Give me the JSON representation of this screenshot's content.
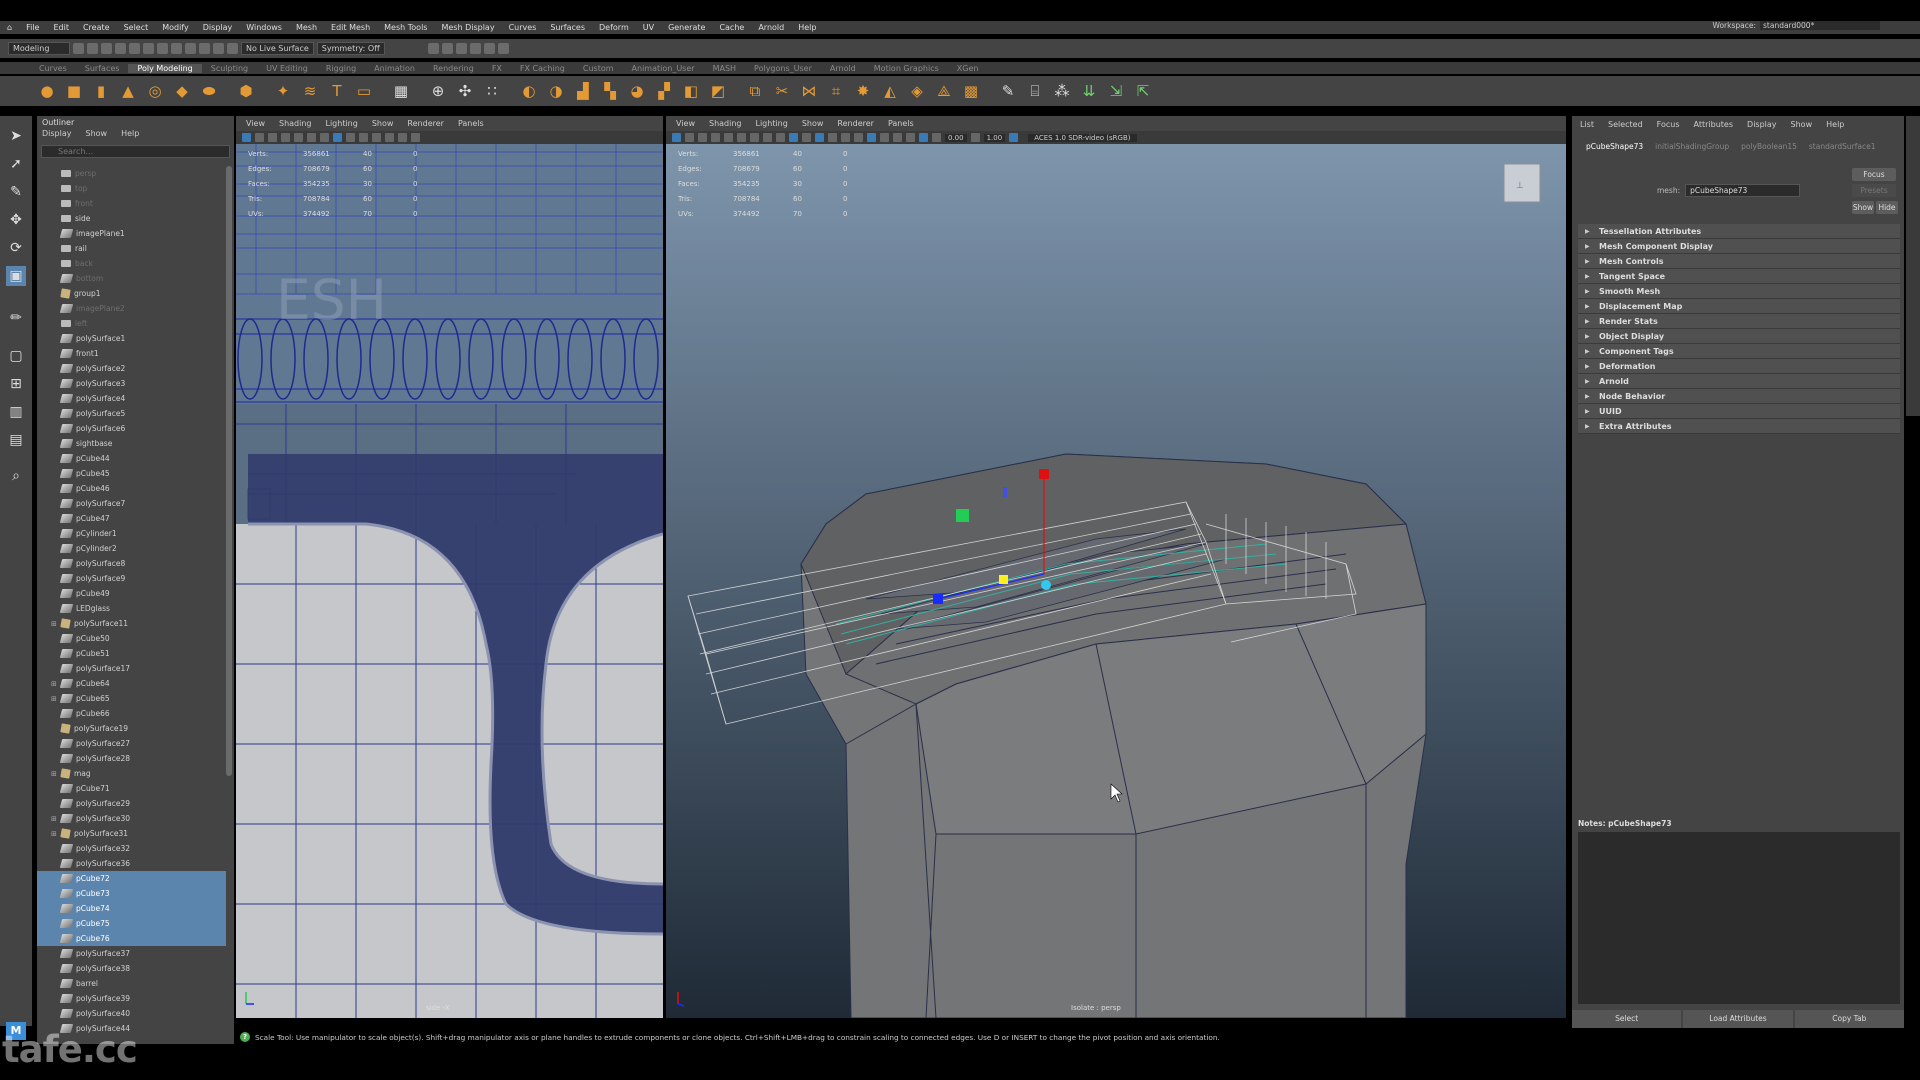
{
  "menubar": [
    "File",
    "Edit",
    "Create",
    "Select",
    "Modify",
    "Display",
    "Windows",
    "Mesh",
    "Edit Mesh",
    "Mesh Tools",
    "Mesh Display",
    "Curves",
    "Surfaces",
    "Deform",
    "UV",
    "Generate",
    "Cache",
    "Arnold",
    "Help"
  ],
  "workspace": {
    "label": "Workspace:",
    "value": "standard000*"
  },
  "status_line": {
    "mode": "Modeling",
    "live_surface": "No Live Surface",
    "symmetry": "Symmetry: Off"
  },
  "shelf_tabs": [
    "Curves",
    "Surfaces",
    "Poly Modeling",
    "Sculpting",
    "UV Editing",
    "Rigging",
    "Animation",
    "Rendering",
    "FX",
    "FX Caching",
    "Custom",
    "Animation_User",
    "MASH",
    "Polygons_User",
    "Arnold",
    "Motion Graphics",
    "XGen"
  ],
  "shelf_active_tab": "Poly Modeling",
  "outliner": {
    "title": "Outliner",
    "menu": [
      "Display",
      "Show",
      "Help"
    ],
    "search_placeholder": "Search...",
    "items": [
      {
        "label": "persp",
        "icon": "cam",
        "dim": true
      },
      {
        "label": "top",
        "icon": "cam",
        "dim": true
      },
      {
        "label": "front",
        "icon": "cam",
        "dim": true
      },
      {
        "label": "side",
        "icon": "cam"
      },
      {
        "label": "imagePlane1",
        "icon": "mesh"
      },
      {
        "label": "rail",
        "icon": "cam"
      },
      {
        "label": "back",
        "icon": "cam",
        "dim": true
      },
      {
        "label": "bottom",
        "icon": "mesh",
        "dim": true
      },
      {
        "label": "group1",
        "icon": "grp"
      },
      {
        "label": "imagePlane2",
        "icon": "mesh",
        "dim": true
      },
      {
        "label": "left",
        "icon": "cam",
        "dim": true
      },
      {
        "label": "polySurface1",
        "icon": "mesh"
      },
      {
        "label": "front1",
        "icon": "mesh"
      },
      {
        "label": "polySurface2",
        "icon": "mesh"
      },
      {
        "label": "polySurface3",
        "icon": "mesh"
      },
      {
        "label": "polySurface4",
        "icon": "mesh"
      },
      {
        "label": "polySurface5",
        "icon": "mesh"
      },
      {
        "label": "polySurface6",
        "icon": "mesh"
      },
      {
        "label": "sightbase",
        "icon": "mesh"
      },
      {
        "label": "pCube44",
        "icon": "mesh"
      },
      {
        "label": "pCube45",
        "icon": "mesh"
      },
      {
        "label": "pCube46",
        "icon": "mesh"
      },
      {
        "label": "polySurface7",
        "icon": "mesh"
      },
      {
        "label": "pCube47",
        "icon": "mesh"
      },
      {
        "label": "pCylinder1",
        "icon": "mesh"
      },
      {
        "label": "pCylinder2",
        "icon": "mesh"
      },
      {
        "label": "polySurface8",
        "icon": "mesh"
      },
      {
        "label": "polySurface9",
        "icon": "mesh"
      },
      {
        "label": "pCube49",
        "icon": "mesh"
      },
      {
        "label": "LEDglass",
        "icon": "mesh"
      },
      {
        "label": "polySurface11",
        "icon": "grp",
        "exp": true
      },
      {
        "label": "pCube50",
        "icon": "mesh"
      },
      {
        "label": "pCube51",
        "icon": "mesh"
      },
      {
        "label": "polySurface17",
        "icon": "mesh"
      },
      {
        "label": "pCube64",
        "icon": "mesh",
        "exp": true
      },
      {
        "label": "pCube65",
        "icon": "mesh",
        "exp": true
      },
      {
        "label": "pCube66",
        "icon": "mesh"
      },
      {
        "label": "polySurface19",
        "icon": "grp"
      },
      {
        "label": "polySurface27",
        "icon": "mesh"
      },
      {
        "label": "polySurface28",
        "icon": "mesh"
      },
      {
        "label": "mag",
        "icon": "grp",
        "exp": true
      },
      {
        "label": "pCube71",
        "icon": "mesh"
      },
      {
        "label": "polySurface29",
        "icon": "mesh"
      },
      {
        "label": "polySurface30",
        "icon": "mesh",
        "exp": true
      },
      {
        "label": "polySurface31",
        "icon": "grp",
        "exp": true
      },
      {
        "label": "polySurface32",
        "icon": "mesh"
      },
      {
        "label": "polySurface36",
        "icon": "mesh"
      },
      {
        "label": "pCube72",
        "icon": "mesh",
        "sel": true
      },
      {
        "label": "pCube73",
        "icon": "mesh",
        "sel": true
      },
      {
        "label": "pCube74",
        "icon": "mesh",
        "sel": true
      },
      {
        "label": "pCube75",
        "icon": "mesh",
        "sel": true
      },
      {
        "label": "pCube76",
        "icon": "mesh",
        "sel": true
      },
      {
        "label": "polySurface37",
        "icon": "mesh"
      },
      {
        "label": "polySurface38",
        "icon": "mesh"
      },
      {
        "label": "barrel",
        "icon": "mesh"
      },
      {
        "label": "polySurface39",
        "icon": "mesh"
      },
      {
        "label": "polySurface40",
        "icon": "mesh"
      },
      {
        "label": "polySurface44",
        "icon": "mesh"
      }
    ]
  },
  "viewport_menu": [
    "View",
    "Shading",
    "Lighting",
    "Show",
    "Renderer",
    "Panels"
  ],
  "hud": {
    "rows": [
      {
        "label": "Verts:",
        "a": "356861",
        "b": "40",
        "c": "0"
      },
      {
        "label": "Edges:",
        "a": "708679",
        "b": "60",
        "c": "0"
      },
      {
        "label": "Faces:",
        "a": "354235",
        "b": "30",
        "c": "0"
      },
      {
        "label": "Tris:",
        "a": "708784",
        "b": "60",
        "c": "0"
      },
      {
        "label": "UVs:",
        "a": "374492",
        "b": "70",
        "c": "0"
      }
    ]
  },
  "viewport_left": {
    "label": "side -X"
  },
  "viewport_right": {
    "label": "Isolate : persp",
    "exposure": "0.00",
    "gamma": "1.00",
    "color_space": "ACES 1.0 SDR-video (sRGB)"
  },
  "attribute_editor": {
    "menu": [
      "List",
      "Selected",
      "Focus",
      "Attributes",
      "Display",
      "Show",
      "Help"
    ],
    "tabs": [
      "pCubeShape73",
      "initialShadingGroup",
      "polyBoolean15",
      "standardSurface1"
    ],
    "active_tab": "pCubeShape73",
    "mesh_label": "mesh:",
    "mesh_value": "pCubeShape73",
    "focus_btn": "Focus",
    "presets_btn": "Presets",
    "show_btn": "Show",
    "hide_btn": "Hide",
    "sections": [
      "Tessellation Attributes",
      "Mesh Component Display",
      "Mesh Controls",
      "Tangent Space",
      "Smooth Mesh",
      "Displacement Map",
      "Render Stats",
      "Object Display",
      "Component Tags",
      "Deformation",
      "Arnold",
      "Node Behavior",
      "UUID",
      "Extra Attributes"
    ],
    "notes_label": "Notes:  pCubeShape73",
    "footer": [
      "Select",
      "Load Attributes",
      "Copy Tab"
    ]
  },
  "help_line": "Scale Tool: Use manipulator to scale object(s). Shift+drag manipulator axis or plane handles to extrude components or clone objects. Ctrl+Shift+LMB+drag to constrain scaling to connected edges. Use D or INSERT to change the pivot position and axis orientation.",
  "watermark": "tafe.cc",
  "colors": {
    "selection": "#5c85ad",
    "gizmo_x": "#e01010",
    "gizmo_y": "#22cc55",
    "gizmo_z": "#1a2bff",
    "gizmo_center": "#ffee22",
    "gizmo_cyan": "#33c9ee"
  }
}
